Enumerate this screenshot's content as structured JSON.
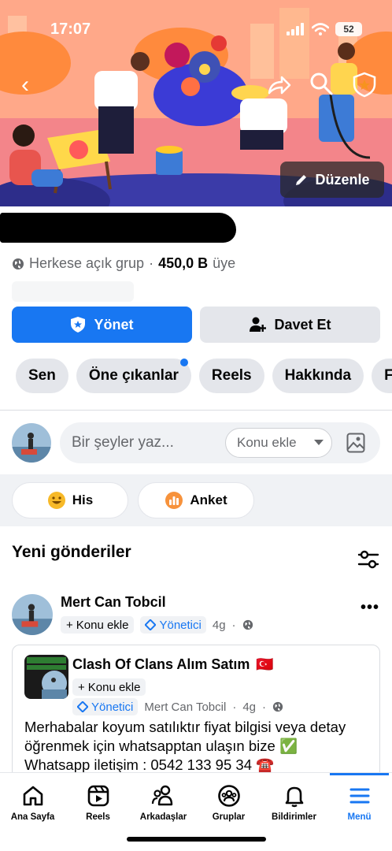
{
  "status_bar": {
    "time": "17:07",
    "battery": "52"
  },
  "cover": {
    "edit_label": "Düzenle"
  },
  "group": {
    "privacy": "Herkese açık grup",
    "separator": "·",
    "member_count": "450,0 B",
    "member_suffix": "üye"
  },
  "actions": {
    "manage_label": "Yönet",
    "invite_label": "Davet Et"
  },
  "tabs": [
    "Sen",
    "Öne çıkanlar",
    "Reels",
    "Hakkında",
    "Fo"
  ],
  "composer": {
    "placeholder": "Bir şeyler yaz...",
    "topic_label": "Konu ekle"
  },
  "quick_actions": {
    "feeling_label": "His",
    "poll_label": "Anket"
  },
  "feed": {
    "section_title": "Yeni gönderiler",
    "post": {
      "author": "Mert Can Tobcil",
      "topic_label": "Konu ekle",
      "role_badge": "Yönetici",
      "time": "4g",
      "shared": {
        "group_name": "Clash Of Clans Alım Satım",
        "flag": "🇹🇷",
        "topic_label": "Konu ekle",
        "role_badge": "Yönetici",
        "author": "Mert Can Tobcil",
        "time": "4g",
        "text_line1": "Merhabalar koyum satılıktır fiyat bilgisi veya detay",
        "text_line2": "öğrenmek için whatsapptan ulaşın bize ✅",
        "text_line3": "Whatsapp iletişim : 0542 133 95 34 ☎️"
      }
    }
  },
  "bottom_nav": [
    {
      "label": "Ana Sayfa",
      "icon": "home-icon"
    },
    {
      "label": "Reels",
      "icon": "reels-icon"
    },
    {
      "label": "Arkadaşlar",
      "icon": "friends-icon"
    },
    {
      "label": "Gruplar",
      "icon": "groups-icon"
    },
    {
      "label": "Bildirimler",
      "icon": "bell-icon"
    },
    {
      "label": "Menü",
      "icon": "menu-icon",
      "active": true
    }
  ],
  "colors": {
    "accent": "#1877f2",
    "tab_bg": "#e4e6eb",
    "surface": "#f0f2f5"
  }
}
